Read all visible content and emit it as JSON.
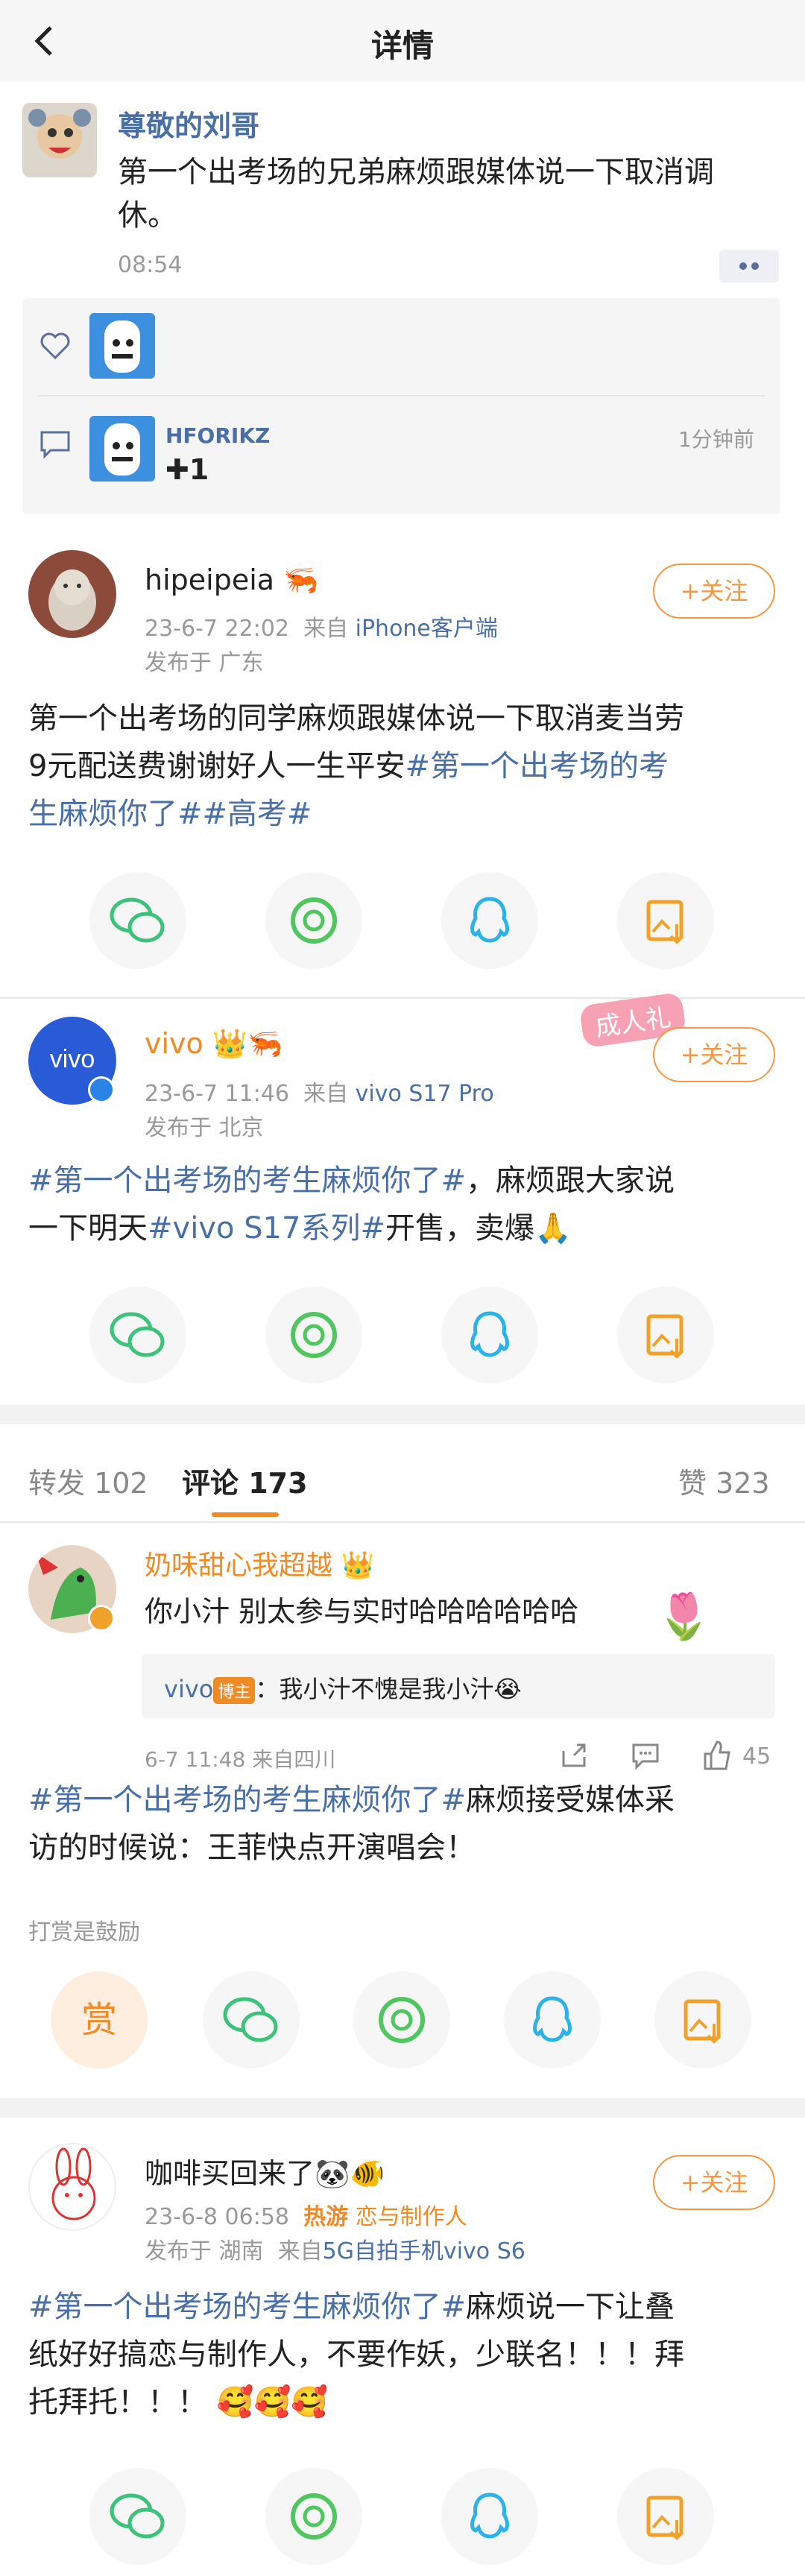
{
  "nav": {
    "title": "详情"
  },
  "repost": {
    "author": "尊敬的刘哥",
    "text_line1": "第一个出考场的兄弟麻烦跟媒体说一下取消调",
    "text_line2": "休。",
    "time": "08:54",
    "comment_user": "HFORIKZ",
    "comment_time": "1分钟前",
    "comment_text": "✚1"
  },
  "post1": {
    "author": "hipeipeia",
    "datetime": "23-6-7 22:02",
    "from_prefix": "来自",
    "source": "iPhone客户端",
    "location": "发布于 广东",
    "follow_label": "+关注",
    "text_line1": "第一个出考场的同学麻烦跟媒体说一下取消麦当劳",
    "text_line2_a": "9元配送费谢谢好人一生平安",
    "text_line2_tag": "#第一个出考场的考",
    "text_line3_tag": "生麻烦你了##高考#"
  },
  "post2": {
    "author": "vivo",
    "datetime": "23-6-7 11:46",
    "from_prefix": "来自",
    "source": "vivo S17 Pro",
    "location": "发布于 北京",
    "follow_label": "+关注",
    "sticker": "成人礼",
    "tag1": "#第一个出考场的考生麻烦你了#",
    "text1": "，麻烦跟大家说",
    "text2": "一下明天",
    "tag2": "#vivo S17系列#",
    "text3": "开售，卖爆🙏"
  },
  "tabs": {
    "repost": "转发 102",
    "comment": "评论 173",
    "like": "赞 323"
  },
  "comment1": {
    "author": "奶味甜心我超越",
    "text": "你小汁 别太参与实时哈哈哈哈哈哈",
    "reply_user": "vivo",
    "reply_badge": "博主",
    "reply_text": "：我小汁不愧是我小汁😭",
    "time": "6-7 11:48  来自四川",
    "likes": "45"
  },
  "post3": {
    "tag": "#第一个出考场的考生麻烦你了#",
    "text1": "麻烦接受媒体采",
    "text2": "访的时候说：王菲快点开演唱会！",
    "tip_label": "打赏是鼓励",
    "reward_label": "赏"
  },
  "post4": {
    "author": "咖啡买回来了🐼🐠",
    "datetime": "23-6-8 06:58",
    "hot": "热游",
    "topic": "恋与制作人",
    "location": "发布于 湖南",
    "from_prefix": "来自",
    "source": "5G自拍手机vivo S6",
    "follow_label": "+关注",
    "tag": "#第一个出考场的考生麻烦你了#",
    "text1": "麻烦说一下让叠",
    "text2": "纸好好搞恋与制作人，不要作妖，少联名！！！拜",
    "text3": "托拜托！！！ 🥰🥰🥰"
  },
  "colors": {
    "accent": "#f29845",
    "link": "#4a6fa5",
    "wechat": "#3cc27b",
    "moments": "#4fc75e",
    "qq": "#2bb3e8",
    "save": "#f0a12a"
  }
}
